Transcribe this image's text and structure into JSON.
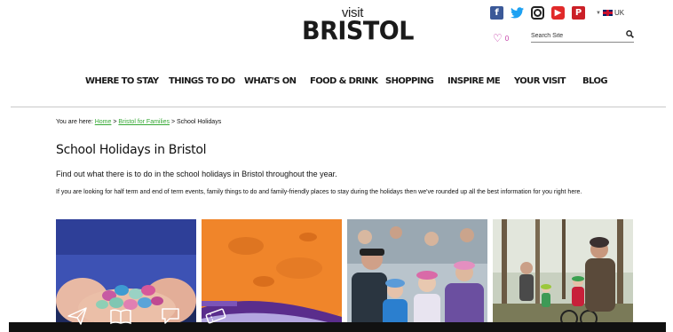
{
  "header": {
    "logo_small": "visit",
    "logo_large": "BRISTOL",
    "social": [
      {
        "name": "facebook-icon",
        "glyph": "f"
      },
      {
        "name": "twitter-icon",
        "glyph": "🐦"
      },
      {
        "name": "instagram-icon",
        "glyph": ""
      },
      {
        "name": "youtube-icon",
        "glyph": "▶"
      },
      {
        "name": "pinterest-icon",
        "glyph": "P"
      }
    ],
    "language": "UK",
    "favourites_count": "0",
    "search_placeholder": "Search Site"
  },
  "nav": {
    "items": [
      "WHERE TO STAY",
      "THINGS TO DO",
      "WHAT'S ON",
      "FOOD & DRINK",
      "SHOPPING",
      "INSPIRE ME",
      "YOUR VISIT",
      "BLOG"
    ]
  },
  "breadcrumb": {
    "prefix": "You are here:",
    "home": "Home",
    "sep1": ">",
    "families": "Bristol for Families",
    "sep2": ">",
    "current": "School Holidays"
  },
  "page": {
    "title": "School Holidays in Bristol",
    "intro": "Find out what there is to do in the school holidays in Bristol throughout the year.",
    "body": "If you are looking for half term and end of term events, family things to do and family-friendly places to stay during the holidays then we've rounded up all the best information for you right here."
  },
  "tiles": [
    {
      "name": "easter-eggs-photo"
    },
    {
      "name": "planet-dome-photo"
    },
    {
      "name": "family-audience-photo"
    },
    {
      "name": "woodland-cycling-photo"
    }
  ],
  "bottom_bar": {
    "icons": [
      "paper-plane-icon",
      "book-icon",
      "chat-icon",
      "ticket-icon"
    ]
  },
  "colors": {
    "link_green": "#36a835",
    "heart_pink": "#c43fa8",
    "facebook_blue": "#3b5998",
    "twitter_blue": "#1da1f2",
    "youtube_red": "#e12a2a",
    "pinterest_red": "#cb2027"
  }
}
